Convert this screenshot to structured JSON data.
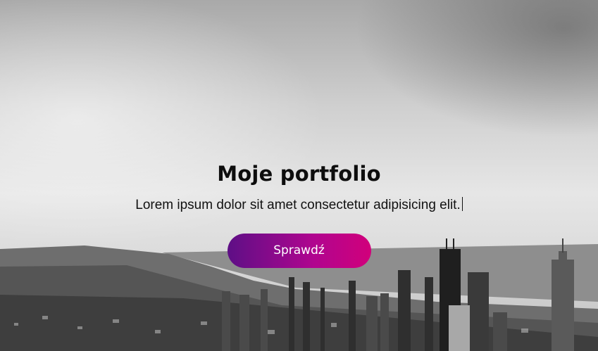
{
  "hero": {
    "title": "Moje portfolio",
    "subtitle": "Lorem ipsum dolor sit amet consectetur adipisicing elit.",
    "cta_label": "Sprawdź"
  },
  "colors": {
    "cta_gradient_start": "#5e0f86",
    "cta_gradient_end": "#d1007b",
    "title_color": "#0d0d0d"
  }
}
